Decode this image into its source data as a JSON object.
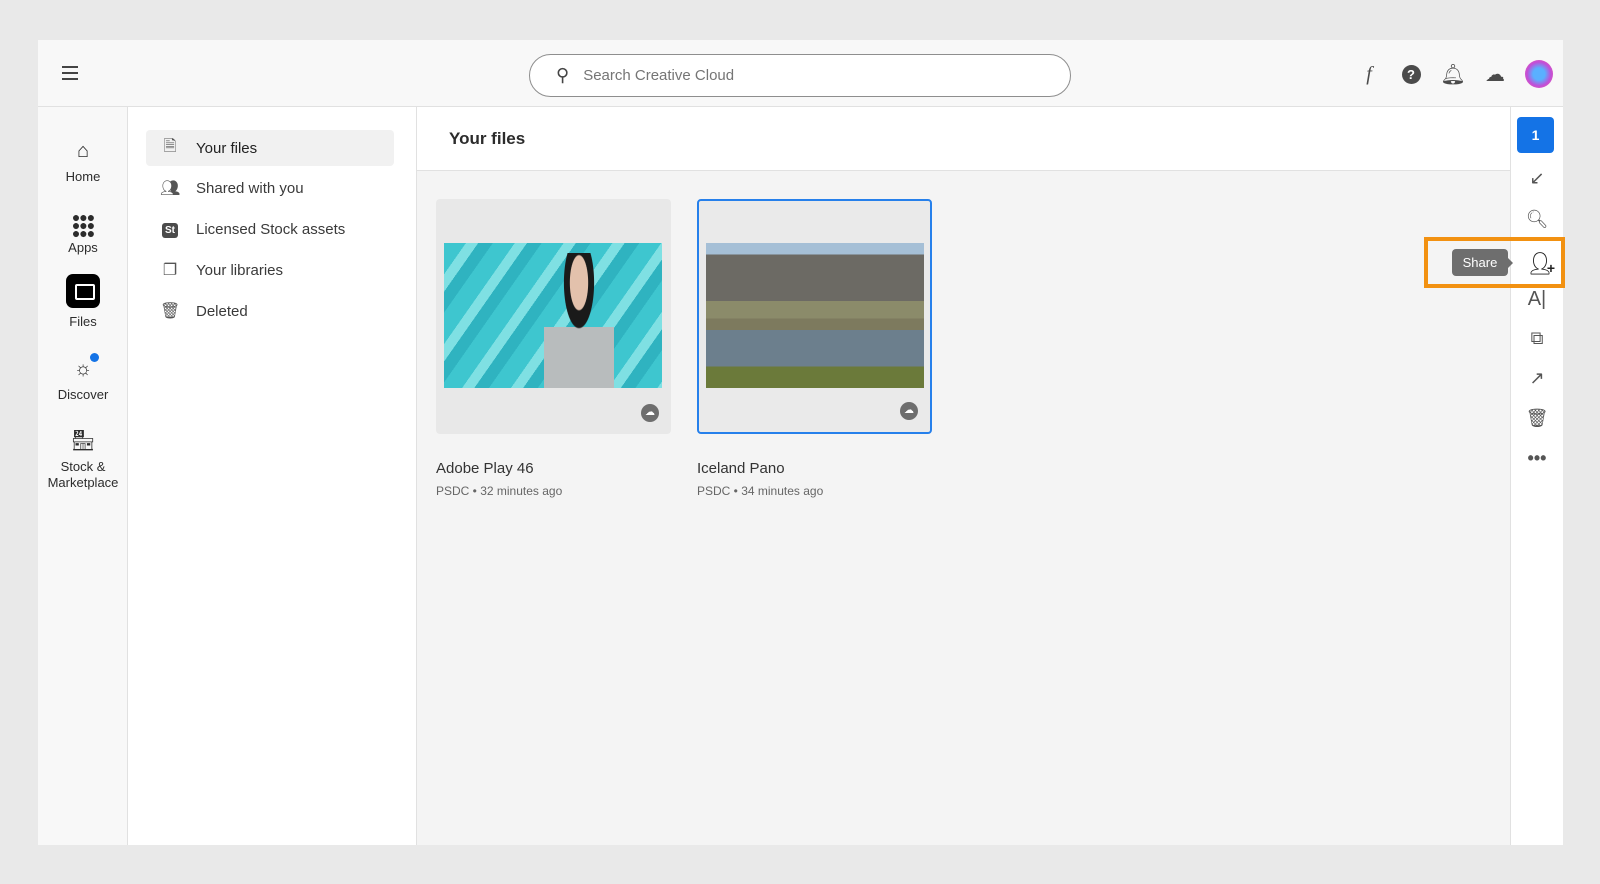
{
  "header": {
    "search_placeholder": "Search Creative Cloud",
    "icons": [
      "menu-icon",
      "fonts-icon",
      "help-icon",
      "bell-icon",
      "cloud-icon",
      "avatar"
    ]
  },
  "rail": {
    "items": [
      {
        "label": "Home",
        "icon": "home-icon"
      },
      {
        "label": "Apps",
        "icon": "apps-grid-icon"
      },
      {
        "label": "Files",
        "icon": "folder-icon",
        "selected": true
      },
      {
        "label": "Discover",
        "icon": "compass-icon",
        "badge": true
      },
      {
        "label": "Stock &\nMarketplace",
        "icon": "store-icon"
      }
    ]
  },
  "nav": {
    "items": [
      {
        "label": "Your files",
        "selected": true
      },
      {
        "label": "Shared with you"
      },
      {
        "label": "Licensed Stock assets",
        "icon_text": "St"
      },
      {
        "label": "Your libraries"
      },
      {
        "label": "Deleted"
      }
    ]
  },
  "main": {
    "title": "Your files",
    "files": [
      {
        "name": "Adobe Play 46",
        "meta": "PSDC • 32 minutes ago",
        "selected": false
      },
      {
        "name": "Iceland Pano",
        "meta": "PSDC • 34 minutes ago",
        "selected": true
      }
    ]
  },
  "actions": {
    "selected_count": "1",
    "tooltip": "Share",
    "highlight_color": "#f29111",
    "accent": "#1473e6"
  }
}
